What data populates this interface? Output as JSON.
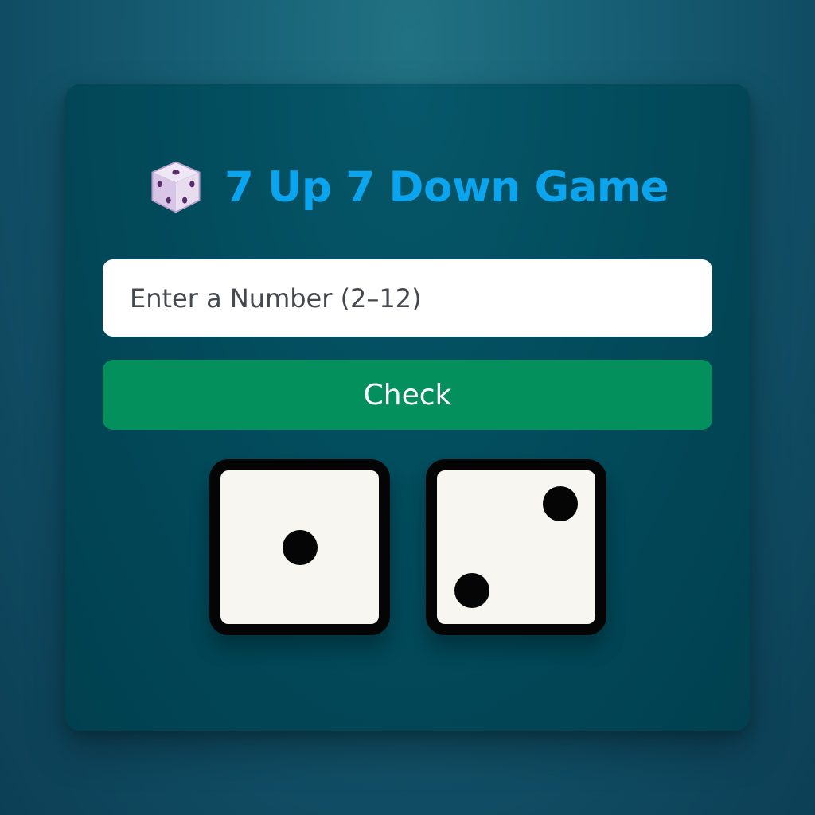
{
  "game": {
    "icon": "dice-icon",
    "title": "7 Up 7 Down Game"
  },
  "number_input": {
    "placeholder": "Enter a Number (2–12)",
    "value": ""
  },
  "check_button": {
    "label": "Check"
  },
  "dice": [
    {
      "value": 1
    },
    {
      "value": 2
    }
  ],
  "colors": {
    "title": "#0aa5ee",
    "check_button": "#04905c",
    "card": "#024c5d",
    "background": "#175f74",
    "die_face": "#f7f6f1",
    "pip": "#050505"
  }
}
